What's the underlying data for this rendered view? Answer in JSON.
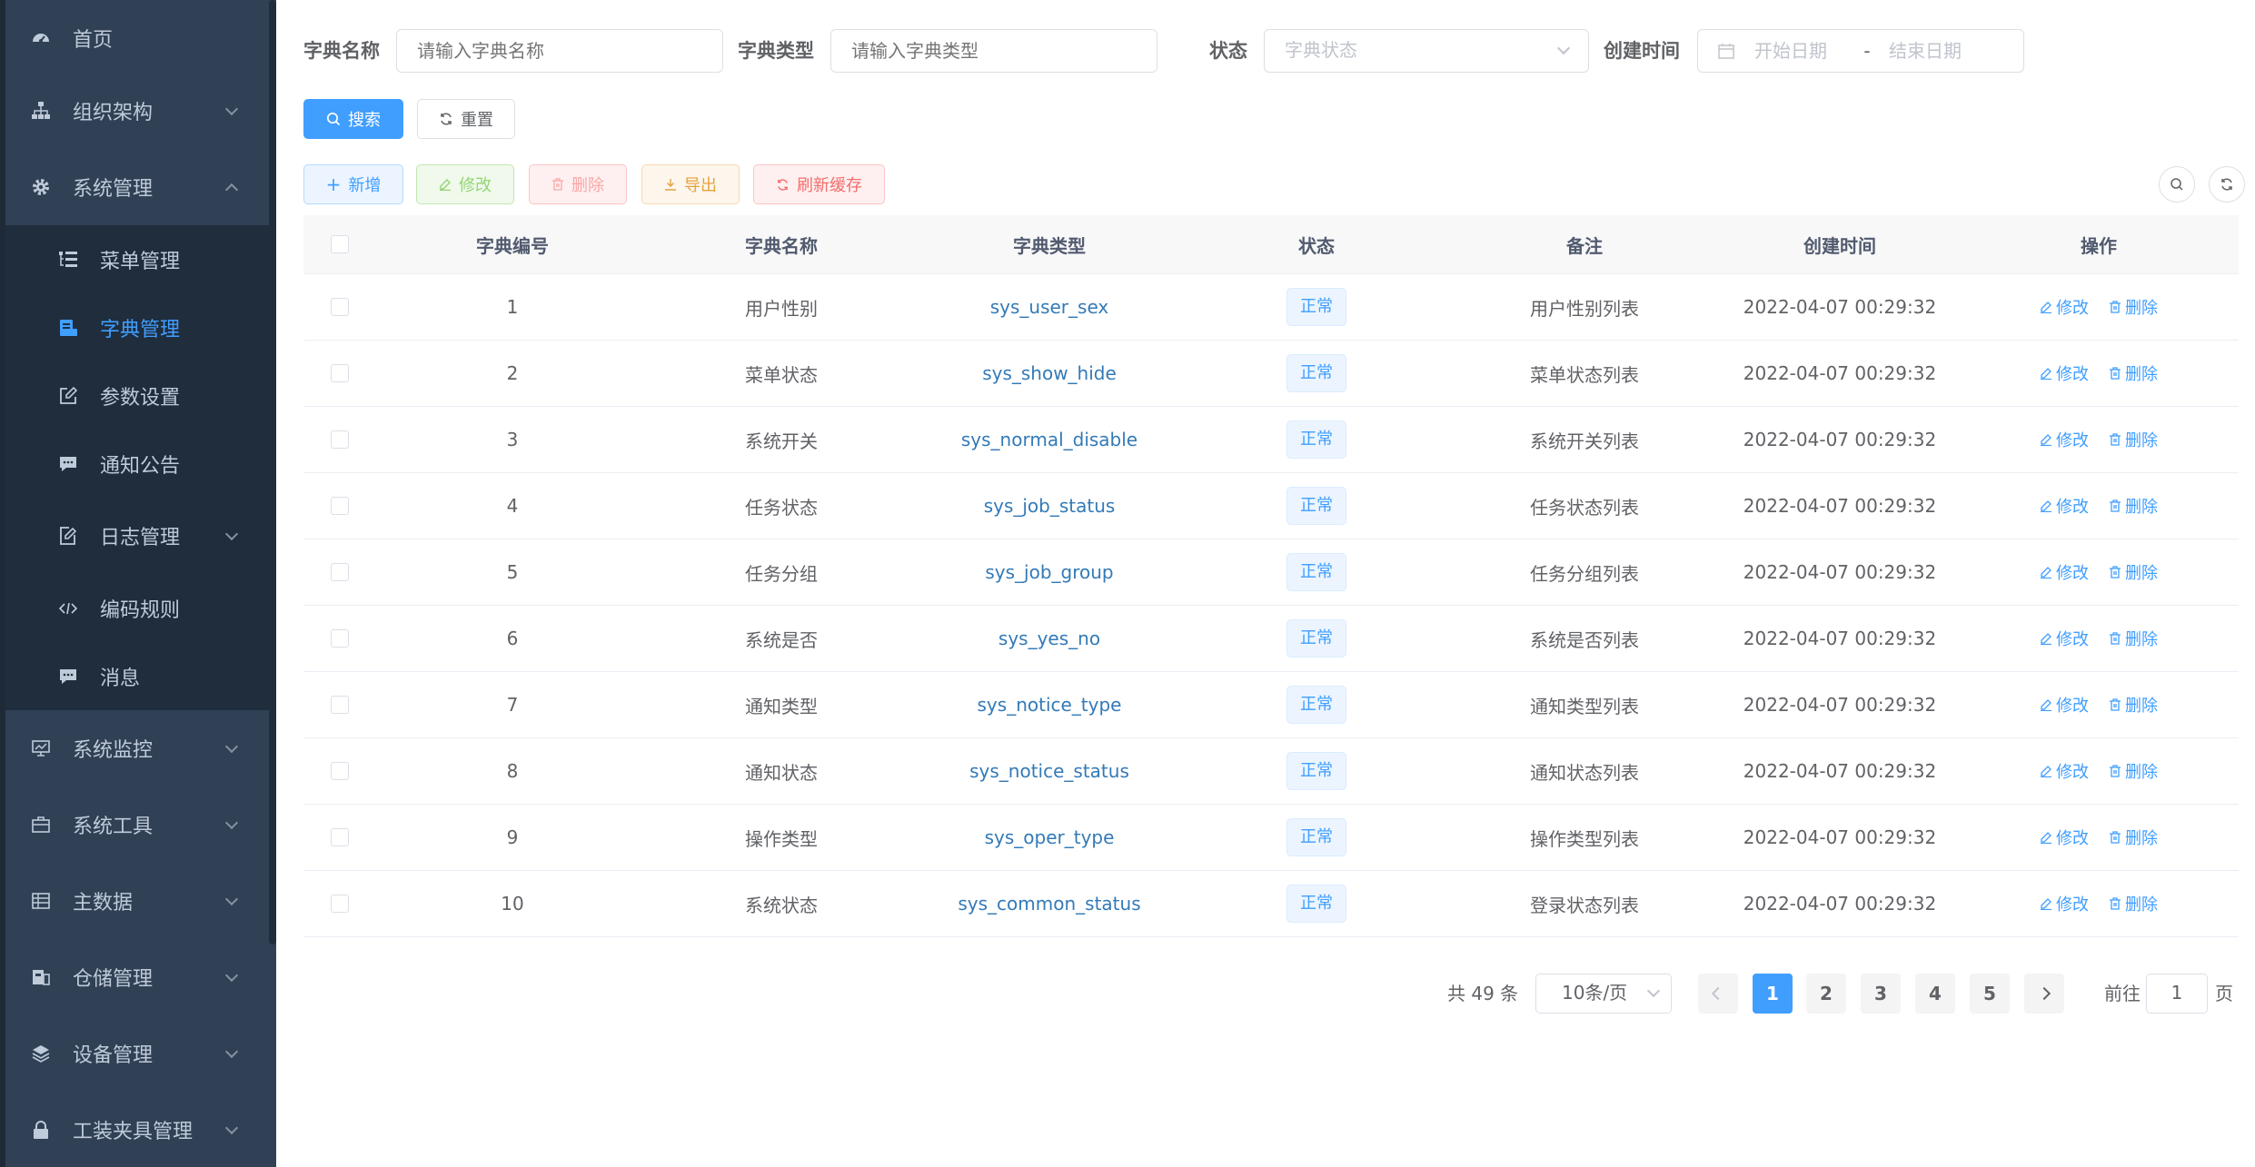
{
  "sidebar": {
    "items": [
      {
        "label": "首页"
      },
      {
        "label": "组织架构"
      },
      {
        "label": "系统管理"
      },
      {
        "label": "菜单管理"
      },
      {
        "label": "字典管理"
      },
      {
        "label": "参数设置"
      },
      {
        "label": "通知公告"
      },
      {
        "label": "日志管理"
      },
      {
        "label": "编码规则"
      },
      {
        "label": "消息"
      },
      {
        "label": "系统监控"
      },
      {
        "label": "系统工具"
      },
      {
        "label": "主数据"
      },
      {
        "label": "仓储管理"
      },
      {
        "label": "设备管理"
      },
      {
        "label": "工装夹具管理"
      }
    ],
    "active_item": "字典管理"
  },
  "search": {
    "dict_name_label": "字典名称",
    "dict_name_placeholder": "请输入字典名称",
    "dict_type_label": "字典类型",
    "dict_type_placeholder": "请输入字典类型",
    "status_label": "状态",
    "status_placeholder": "字典状态",
    "created_label": "创建时间",
    "start_placeholder": "开始日期",
    "date_sep": "-",
    "end_placeholder": "结束日期",
    "search_button": "搜索",
    "reset_button": "重置"
  },
  "toolbar": {
    "add": "新增",
    "edit": "修改",
    "delete": "删除",
    "export": "导出",
    "refresh_cache": "刷新缓存"
  },
  "table": {
    "columns": [
      "字典编号",
      "字典名称",
      "字典类型",
      "状态",
      "备注",
      "创建时间",
      "操作"
    ],
    "rows": [
      {
        "id": "1",
        "name": "用户性别",
        "type": "sys_user_sex",
        "status": "正常",
        "remark": "用户性别列表",
        "created": "2022-04-07 00:29:32",
        "edit": "修改",
        "del": "删除"
      },
      {
        "id": "2",
        "name": "菜单状态",
        "type": "sys_show_hide",
        "status": "正常",
        "remark": "菜单状态列表",
        "created": "2022-04-07 00:29:32",
        "edit": "修改",
        "del": "删除"
      },
      {
        "id": "3",
        "name": "系统开关",
        "type": "sys_normal_disable",
        "status": "正常",
        "remark": "系统开关列表",
        "created": "2022-04-07 00:29:32",
        "edit": "修改",
        "del": "删除"
      },
      {
        "id": "4",
        "name": "任务状态",
        "type": "sys_job_status",
        "status": "正常",
        "remark": "任务状态列表",
        "created": "2022-04-07 00:29:32",
        "edit": "修改",
        "del": "删除"
      },
      {
        "id": "5",
        "name": "任务分组",
        "type": "sys_job_group",
        "status": "正常",
        "remark": "任务分组列表",
        "created": "2022-04-07 00:29:32",
        "edit": "修改",
        "del": "删除"
      },
      {
        "id": "6",
        "name": "系统是否",
        "type": "sys_yes_no",
        "status": "正常",
        "remark": "系统是否列表",
        "created": "2022-04-07 00:29:32",
        "edit": "修改",
        "del": "删除"
      },
      {
        "id": "7",
        "name": "通知类型",
        "type": "sys_notice_type",
        "status": "正常",
        "remark": "通知类型列表",
        "created": "2022-04-07 00:29:32",
        "edit": "修改",
        "del": "删除"
      },
      {
        "id": "8",
        "name": "通知状态",
        "type": "sys_notice_status",
        "status": "正常",
        "remark": "通知状态列表",
        "created": "2022-04-07 00:29:32",
        "edit": "修改",
        "del": "删除"
      },
      {
        "id": "9",
        "name": "操作类型",
        "type": "sys_oper_type",
        "status": "正常",
        "remark": "操作类型列表",
        "created": "2022-04-07 00:29:32",
        "edit": "修改",
        "del": "删除"
      },
      {
        "id": "10",
        "name": "系统状态",
        "type": "sys_common_status",
        "status": "正常",
        "remark": "登录状态列表",
        "created": "2022-04-07 00:29:32",
        "edit": "修改",
        "del": "删除"
      }
    ]
  },
  "pagination": {
    "total_text": "共 49 条",
    "page_size": "10条/页",
    "pages": [
      "1",
      "2",
      "3",
      "4",
      "5"
    ],
    "current_page": "1",
    "goto_label": "前往",
    "goto_value": "1",
    "goto_suffix": "页"
  },
  "colors": {
    "sidebar_bg": "#304156",
    "submenu_bg": "#1f2d3d",
    "accent": "#409eff",
    "danger": "#f56c6c",
    "warning": "#e6a23c",
    "success": "#67c23a"
  }
}
